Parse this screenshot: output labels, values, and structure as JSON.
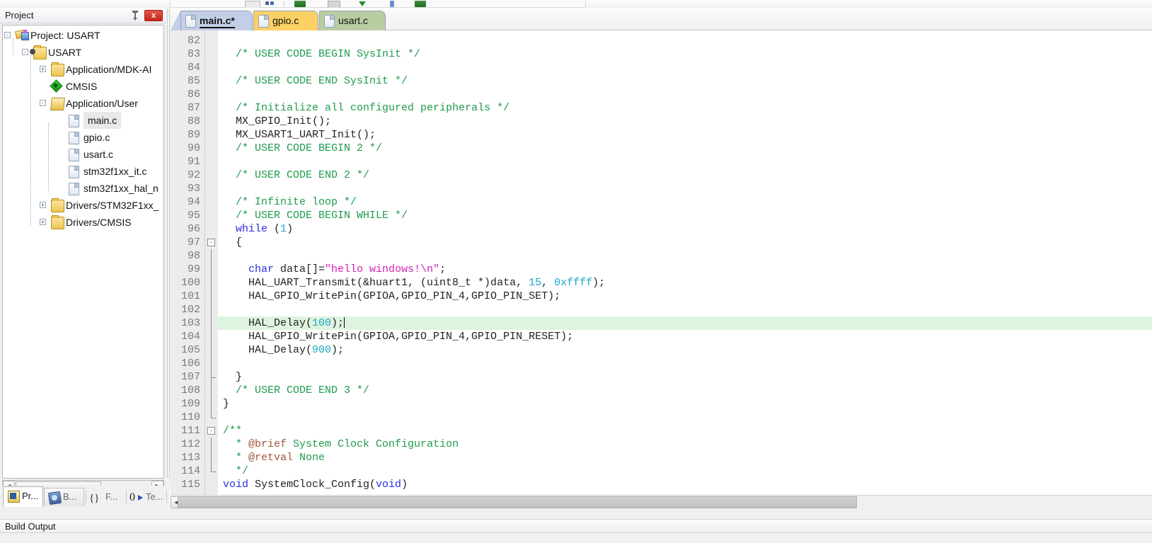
{
  "toolbar": {
    "icons": [
      "box-icon",
      "small-icons-icon",
      "separator",
      "build-icon",
      "rebuild-icon",
      "download-icon",
      "target-icon",
      "manage-project-icon"
    ]
  },
  "project_panel": {
    "title": "Project",
    "pin_icon": "pin-icon",
    "close_label": "x",
    "hscroll": {
      "left_arrow": "◀",
      "right_arrow": "▶"
    },
    "items": [
      {
        "label": "Project: USART",
        "indent": 0,
        "expander": "-",
        "icon": "project-icon",
        "selected": false
      },
      {
        "label": "USART",
        "indent": 1,
        "expander": "-",
        "icon": "target-folder-icon",
        "selected": false
      },
      {
        "label": "Application/MDK-AI",
        "indent": 2,
        "expander": "+",
        "icon": "folder-icon",
        "selected": false
      },
      {
        "label": "CMSIS",
        "indent": 2,
        "expander": "",
        "icon": "cmsis-icon",
        "selected": false
      },
      {
        "label": "Application/User",
        "indent": 2,
        "expander": "-",
        "icon": "folder-open-icon",
        "selected": false
      },
      {
        "label": "main.c",
        "indent": 3,
        "expander": "",
        "icon": "file-icon",
        "selected": true
      },
      {
        "label": "gpio.c",
        "indent": 3,
        "expander": "",
        "icon": "file-icon",
        "selected": false
      },
      {
        "label": "usart.c",
        "indent": 3,
        "expander": "",
        "icon": "file-icon",
        "selected": false
      },
      {
        "label": "stm32f1xx_it.c",
        "indent": 3,
        "expander": "",
        "icon": "file-icon",
        "selected": false
      },
      {
        "label": "stm32f1xx_hal_n",
        "indent": 3,
        "expander": "",
        "icon": "file-icon",
        "selected": false
      },
      {
        "label": "Drivers/STM32F1xx_",
        "indent": 2,
        "expander": "+",
        "icon": "folder-icon",
        "selected": false
      },
      {
        "label": "Drivers/CMSIS",
        "indent": 2,
        "expander": "+",
        "icon": "folder-icon",
        "selected": false
      }
    ]
  },
  "dock_tabs": [
    {
      "label": "Pr...",
      "icon": "project-window-icon",
      "active": true
    },
    {
      "label": "B...",
      "icon": "books-icon",
      "active": false
    },
    {
      "label": "F...",
      "icon": "braces-icon",
      "active": false
    },
    {
      "label": "Te...",
      "icon": "templates-icon",
      "active": false
    }
  ],
  "editor": {
    "tabs": [
      {
        "label": "main.c*",
        "state": "active-modified",
        "color": "#c3cfe8"
      },
      {
        "label": "gpio.c",
        "state": "inactive",
        "color": "#fbd166"
      },
      {
        "label": "usart.c",
        "state": "inactive",
        "color": "#b9cea0"
      }
    ],
    "highlighted_line": 103,
    "first_line": 82,
    "last_line": 115,
    "colors": {
      "comment": "#1f9b4d",
      "keyword": "#2d2de0",
      "string": "#d61fb6",
      "number": "#19a8c4",
      "doxygen": "#a4553b",
      "current_line_bg": "#dff4e0",
      "gutter_bg": "#ececec"
    },
    "code_lines": [
      {
        "n": 82,
        "tokens": [],
        "fold": ""
      },
      {
        "n": 83,
        "tokens": [
          {
            "t": "  ",
            "c": "plain"
          },
          {
            "t": "/* USER CODE BEGIN SysInit */",
            "c": "cmt"
          }
        ],
        "fold": ""
      },
      {
        "n": 84,
        "tokens": [],
        "fold": ""
      },
      {
        "n": 85,
        "tokens": [
          {
            "t": "  ",
            "c": "plain"
          },
          {
            "t": "/* USER CODE END SysInit */",
            "c": "cmt"
          }
        ],
        "fold": ""
      },
      {
        "n": 86,
        "tokens": [],
        "fold": ""
      },
      {
        "n": 87,
        "tokens": [
          {
            "t": "  ",
            "c": "plain"
          },
          {
            "t": "/* Initialize all configured peripherals */",
            "c": "cmt"
          }
        ],
        "fold": ""
      },
      {
        "n": 88,
        "tokens": [
          {
            "t": "  MX_GPIO_Init();",
            "c": "plain"
          }
        ],
        "fold": ""
      },
      {
        "n": 89,
        "tokens": [
          {
            "t": "  MX_USART1_UART_Init();",
            "c": "plain"
          }
        ],
        "fold": ""
      },
      {
        "n": 90,
        "tokens": [
          {
            "t": "  ",
            "c": "plain"
          },
          {
            "t": "/* USER CODE BEGIN 2 */",
            "c": "cmt"
          }
        ],
        "fold": ""
      },
      {
        "n": 91,
        "tokens": [],
        "fold": ""
      },
      {
        "n": 92,
        "tokens": [
          {
            "t": "  ",
            "c": "plain"
          },
          {
            "t": "/* USER CODE END 2 */",
            "c": "cmt"
          }
        ],
        "fold": ""
      },
      {
        "n": 93,
        "tokens": [],
        "fold": ""
      },
      {
        "n": 94,
        "tokens": [
          {
            "t": "  ",
            "c": "plain"
          },
          {
            "t": "/* Infinite loop */",
            "c": "cmt"
          }
        ],
        "fold": ""
      },
      {
        "n": 95,
        "tokens": [
          {
            "t": "  ",
            "c": "plain"
          },
          {
            "t": "/* USER CODE BEGIN WHILE */",
            "c": "cmt"
          }
        ],
        "fold": ""
      },
      {
        "n": 96,
        "tokens": [
          {
            "t": "  ",
            "c": "plain"
          },
          {
            "t": "while",
            "c": "kw"
          },
          {
            "t": " (",
            "c": "plain"
          },
          {
            "t": "1",
            "c": "num"
          },
          {
            "t": ")",
            "c": "plain"
          }
        ],
        "fold": ""
      },
      {
        "n": 97,
        "tokens": [
          {
            "t": "  {",
            "c": "plain"
          }
        ],
        "fold": "minus"
      },
      {
        "n": 98,
        "tokens": [],
        "fold": "bar"
      },
      {
        "n": 99,
        "tokens": [
          {
            "t": "    ",
            "c": "plain"
          },
          {
            "t": "char",
            "c": "kw"
          },
          {
            "t": " data[]=",
            "c": "plain"
          },
          {
            "t": "\"hello windows!\\n\"",
            "c": "str"
          },
          {
            "t": ";",
            "c": "plain"
          }
        ],
        "fold": "bar"
      },
      {
        "n": 100,
        "tokens": [
          {
            "t": "    HAL_UART_Transmit(&huart1, (uint8_t *)data, ",
            "c": "plain"
          },
          {
            "t": "15",
            "c": "num"
          },
          {
            "t": ", ",
            "c": "plain"
          },
          {
            "t": "0xffff",
            "c": "num"
          },
          {
            "t": ");",
            "c": "plain"
          }
        ],
        "fold": "bar"
      },
      {
        "n": 101,
        "tokens": [
          {
            "t": "    HAL_GPIO_WritePin(GPIOA,GPIO_PIN_4,GPIO_PIN_SET);",
            "c": "plain"
          }
        ],
        "fold": "bar"
      },
      {
        "n": 102,
        "tokens": [],
        "fold": "bar"
      },
      {
        "n": 103,
        "tokens": [
          {
            "t": "    HAL_Delay(",
            "c": "plain"
          },
          {
            "t": "100",
            "c": "num"
          },
          {
            "t": ");",
            "c": "plain"
          }
        ],
        "fold": "bar",
        "cursor": true
      },
      {
        "n": 104,
        "tokens": [
          {
            "t": "    HAL_GPIO_WritePin(GPIOA,GPIO_PIN_4,GPIO_PIN_RESET);",
            "c": "plain"
          }
        ],
        "fold": "bar"
      },
      {
        "n": 105,
        "tokens": [
          {
            "t": "    HAL_Delay(",
            "c": "plain"
          },
          {
            "t": "900",
            "c": "num"
          },
          {
            "t": ");",
            "c": "plain"
          }
        ],
        "fold": "bar"
      },
      {
        "n": 106,
        "tokens": [],
        "fold": "bar"
      },
      {
        "n": 107,
        "tokens": [
          {
            "t": "  }",
            "c": "plain"
          }
        ],
        "fold": "end"
      },
      {
        "n": 108,
        "tokens": [
          {
            "t": "  ",
            "c": "plain"
          },
          {
            "t": "/* USER CODE END 3 */",
            "c": "cmt"
          }
        ],
        "fold": "bar2"
      },
      {
        "n": 109,
        "tokens": [
          {
            "t": "}",
            "c": "plain"
          }
        ],
        "fold": "bar2"
      },
      {
        "n": 110,
        "tokens": [],
        "fold": "end2"
      },
      {
        "n": 111,
        "tokens": [
          {
            "t": "/**",
            "c": "cmt"
          }
        ],
        "fold": "minus"
      },
      {
        "n": 112,
        "tokens": [
          {
            "t": "  * ",
            "c": "cmt"
          },
          {
            "t": "@brief",
            "c": "dox"
          },
          {
            "t": " System Clock Configuration",
            "c": "cmt"
          }
        ],
        "fold": "bar"
      },
      {
        "n": 113,
        "tokens": [
          {
            "t": "  * ",
            "c": "cmt"
          },
          {
            "t": "@retval",
            "c": "dox"
          },
          {
            "t": " None",
            "c": "cmt"
          }
        ],
        "fold": "bar"
      },
      {
        "n": 114,
        "tokens": [
          {
            "t": "  */",
            "c": "cmt"
          }
        ],
        "fold": "end"
      },
      {
        "n": 115,
        "tokens": [
          {
            "t": "void",
            "c": "kw"
          },
          {
            "t": " SystemClock_Config(",
            "c": "plain"
          },
          {
            "t": "void",
            "c": "kw"
          },
          {
            "t": ")",
            "c": "plain"
          }
        ],
        "fold": ""
      }
    ]
  },
  "build_output": {
    "title": "Build Output"
  }
}
